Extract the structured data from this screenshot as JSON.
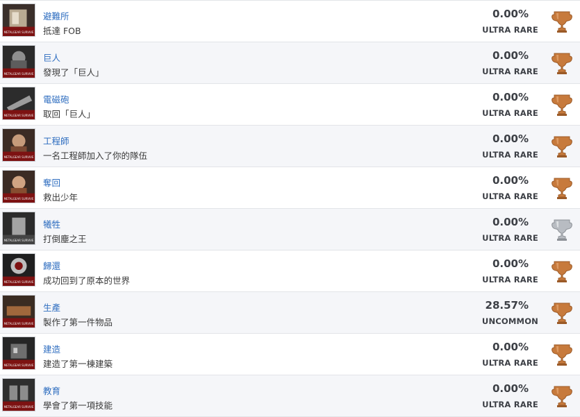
{
  "colors": {
    "bronze": "#c77a3c",
    "silver": "#b8bcc2",
    "link": "#2f6ec0"
  },
  "trophies": [
    {
      "name": "避難所",
      "description": "抵達 FOB",
      "percent": "0.00%",
      "rarity": "ULTRA RARE",
      "trophy_type": "bronze",
      "icon": "fob-shelter-icon",
      "thumb_logo": "METALGEAR SURVIVE"
    },
    {
      "name": "巨人",
      "description": "發現了「巨人」",
      "percent": "0.00%",
      "rarity": "ULTRA RARE",
      "trophy_type": "bronze",
      "icon": "giant-mech-icon",
      "thumb_logo": "METALGEAR SURVIVE"
    },
    {
      "name": "電磁砲",
      "description": "取回「巨人」",
      "percent": "0.00%",
      "rarity": "ULTRA RARE",
      "trophy_type": "bronze",
      "icon": "railgun-icon",
      "thumb_logo": "METALGEAR SURVIVE"
    },
    {
      "name": "工程師",
      "description": "一名工程師加入了你的隊伍",
      "percent": "0.00%",
      "rarity": "ULTRA RARE",
      "trophy_type": "bronze",
      "icon": "engineer-portrait-icon",
      "thumb_logo": "METALGEAR SURVIVE"
    },
    {
      "name": "奪回",
      "description": "救出少年",
      "percent": "0.00%",
      "rarity": "ULTRA RARE",
      "trophy_type": "bronze",
      "icon": "rescue-portrait-icon",
      "thumb_logo": "METALGEAR SURVIVE"
    },
    {
      "name": "犧牲",
      "description": "打倒塵之王",
      "percent": "0.00%",
      "rarity": "ULTRA RARE",
      "trophy_type": "silver",
      "icon": "dust-king-icon",
      "thumb_logo": "METALGEAR SURVIVE"
    },
    {
      "name": "歸還",
      "description": "成功回到了原本的世界",
      "percent": "0.00%",
      "rarity": "ULTRA RARE",
      "trophy_type": "bronze",
      "icon": "return-world-icon",
      "thumb_logo": "METALGEAR SURVIVE"
    },
    {
      "name": "生產",
      "description": "製作了第一件物品",
      "percent": "28.57%",
      "rarity": "UNCOMMON",
      "trophy_type": "bronze",
      "icon": "workbench-icon",
      "thumb_logo": "METALGEAR SURVIVE"
    },
    {
      "name": "建造",
      "description": "建造了第一棟建築",
      "percent": "0.00%",
      "rarity": "ULTRA RARE",
      "trophy_type": "bronze",
      "icon": "building-icon",
      "thumb_logo": "METALGEAR SURVIVE"
    },
    {
      "name": "教育",
      "description": "學會了第一項技能",
      "percent": "0.00%",
      "rarity": "ULTRA RARE",
      "trophy_type": "bronze",
      "icon": "skill-book-icon",
      "thumb_logo": "METALGEAR SURVIVE"
    }
  ]
}
